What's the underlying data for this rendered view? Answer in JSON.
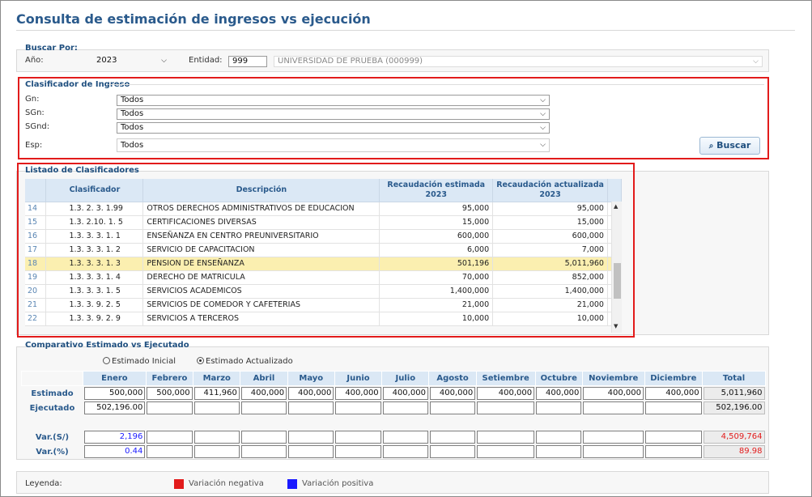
{
  "page": {
    "title": "Consulta de estimación de ingresos vs ejecución"
  },
  "buscar": {
    "legend": "Buscar Por:",
    "anio_label": "Año:",
    "anio_value": "2023",
    "entidad_label": "Entidad:",
    "entidad_code": "999",
    "entidad_name": "UNIVERSIDAD DE PRUEBA (000999)"
  },
  "clasificador": {
    "legend": "Clasificador de Ingreso",
    "fields": [
      {
        "label": "Gn:",
        "value": "Todos"
      },
      {
        "label": "SGn:",
        "value": "Todos"
      },
      {
        "label": "SGnd:",
        "value": "Todos"
      },
      {
        "label": "Esp:",
        "value": "Todos"
      }
    ],
    "search_button": "Buscar"
  },
  "listado": {
    "legend": "Listado de Clasificadores",
    "headers": {
      "clasificador": "Clasificador",
      "descripcion": "Descripción",
      "estimada": "Recaudación estimada",
      "estimada_year": "2023",
      "actualizada": "Recaudación actualizada",
      "actualizada_year": "2023"
    },
    "rows": [
      {
        "n": "14",
        "code": "1.3. 2. 3. 1.99",
        "desc": "OTROS DERECHOS ADMINISTRATIVOS DE EDUCACION",
        "est": "95,000",
        "act": "95,000"
      },
      {
        "n": "15",
        "code": "1.3. 2.10. 1. 5",
        "desc": "CERTIFICACIONES DIVERSAS",
        "est": "15,000",
        "act": "15,000"
      },
      {
        "n": "16",
        "code": "1.3. 3. 3. 1. 1",
        "desc": "ENSEÑANZA EN CENTRO PREUNIVERSITARIO",
        "est": "600,000",
        "act": "600,000"
      },
      {
        "n": "17",
        "code": "1.3. 3. 3. 1. 2",
        "desc": "SERVICIO DE CAPACITACION",
        "est": "6,000",
        "act": "7,000"
      },
      {
        "n": "18",
        "code": "1.3. 3. 3. 1. 3",
        "desc": "PENSION DE ENSEÑANZA",
        "est": "501,196",
        "act": "5,011,960"
      },
      {
        "n": "19",
        "code": "1.3. 3. 3. 1. 4",
        "desc": "DERECHO DE MATRICULA",
        "est": "70,000",
        "act": "852,000"
      },
      {
        "n": "20",
        "code": "1.3. 3. 3. 1. 5",
        "desc": "SERVICIOS ACADEMICOS",
        "est": "1,400,000",
        "act": "1,400,000"
      },
      {
        "n": "21",
        "code": "1.3. 3. 9. 2. 5",
        "desc": "SERVICIOS DE COMEDOR Y CAFETERIAS",
        "est": "21,000",
        "act": "21,000"
      },
      {
        "n": "22",
        "code": "1.3. 3. 9. 2. 9",
        "desc": "SERVICIOS A TERCEROS",
        "est": "10,000",
        "act": "10,000"
      }
    ]
  },
  "comparativo": {
    "legend": "Comparativo Estimado vs Ejecutado",
    "radio_inicial": "Estimado Inicial",
    "radio_actualizado": "Estimado Actualizado",
    "months": [
      "Enero",
      "Febrero",
      "Marzo",
      "Abril",
      "Mayo",
      "Junio",
      "Julio",
      "Agosto",
      "Setiembre",
      "Octubre",
      "Noviembre",
      "Diciembre"
    ],
    "total_label": "Total",
    "row_estimado": "Estimado",
    "row_ejecutado": "Ejecutado",
    "row_var_s": "Var.(S/)",
    "row_var_p": "Var.(%)",
    "estimado": [
      "500,000",
      "500,000",
      "411,960",
      "400,000",
      "400,000",
      "400,000",
      "400,000",
      "400,000",
      "400,000",
      "400,000",
      "400,000",
      "400,000"
    ],
    "estimado_total": "5,011,960",
    "ejecutado": [
      "502,196.00",
      "",
      "",
      "",
      "",
      "",
      "",
      "",
      "",
      "",
      "",
      ""
    ],
    "ejecutado_total": "502,196.00",
    "var_s": [
      "2,196",
      "",
      "",
      "",
      "",
      "",
      "",
      "",
      "",
      "",
      "",
      ""
    ],
    "var_s_total": "4,509,764",
    "var_p": [
      "0.44",
      "",
      "",
      "",
      "",
      "",
      "",
      "",
      "",
      "",
      "",
      ""
    ],
    "var_p_total": "89.98"
  },
  "leyenda": {
    "label": "Leyenda:",
    "negativa": "Variación negativa",
    "positiva": "Variación positiva",
    "color_negativa": "#e21b1b",
    "color_positiva": "#1a1aff"
  }
}
